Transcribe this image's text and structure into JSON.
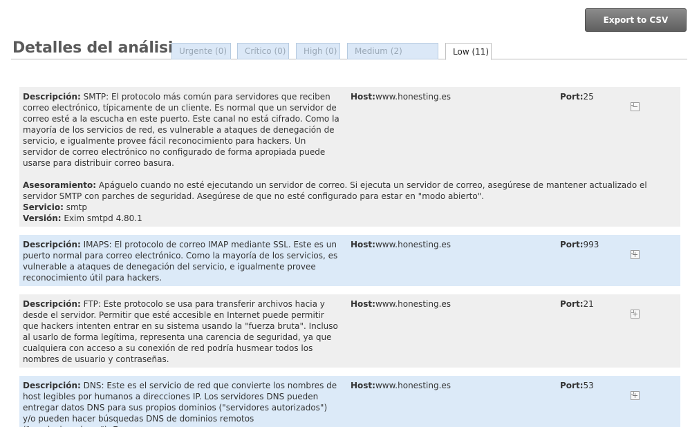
{
  "toolbar": {
    "export_label": "Export to CSV"
  },
  "page": {
    "title": "Detalles del análisis"
  },
  "tabs": [
    {
      "label": "Urgente (0)",
      "active": false
    },
    {
      "label": "Crítico (0)",
      "active": false
    },
    {
      "label": "High (0)",
      "active": false
    },
    {
      "label": "Medium (2)",
      "active": false
    },
    {
      "label": "Low (11)",
      "active": true
    }
  ],
  "labels": {
    "description": "Descripción:",
    "host": "Host:",
    "port": "Port:",
    "advice": "Asesoramiento:",
    "service": "Servicio:",
    "version": "Versión:"
  },
  "icons": {
    "collapse": "collapse-icon",
    "expand": "expand-icon"
  },
  "colors": {
    "row_gray": "#efefef",
    "row_blue": "#dceaf8",
    "tab_inactive": "#dbe8f7"
  },
  "results": [
    {
      "description": "SMTP: El protocolo más común para servidores que reciben correo electrónico, típicamente de un cliente. Es normal que un servidor de correo esté a la escucha en este puerto. Este canal no está cifrado. Como la mayoría de los servicios de red, es vulnerable a ataques de denegación de servicio, e igualmente provee fácil reconocimiento para hackers. Un servidor de correo electrónico no configurado de forma apropiada puede usarse para distribuir correo basura.",
      "host": "www.honesting.es",
      "port": "25",
      "expanded": true,
      "advice": "Apáguelo cuando no esté ejecutando un servidor de correo. Si ejecuta un servidor de correo, asegúrese de mantener actualizado el servidor SMTP con parches de seguridad. Asegúrese de que no esté configurado para estar en \"modo abierto\".",
      "service": "smtp",
      "version": "Exim smtpd 4.80.1"
    },
    {
      "description": "IMAPS: El protocolo de correo IMAP mediante SSL. Este es un puerto normal para correo electrónico. Como la mayoría de los servicios, es vulnerable a ataques de denegación del servicio, e igualmente provee reconocimiento útil para hackers.",
      "host": "www.honesting.es",
      "port": "993",
      "expanded": false
    },
    {
      "description": "FTP: Este protocolo se usa para transferir archivos hacia y desde el servidor. Permitir que esté accesible en Internet puede permitir que hackers intenten entrar en su sistema usando la \"fuerza bruta\". Incluso al usarlo de forma legítima, representa una carencia de seguridad, ya que cualquiera con acceso a su conexión de red podría husmear todos los nombres de usuario y contraseñas.",
      "host": "www.honesting.es",
      "port": "21",
      "expanded": false
    },
    {
      "description": "DNS: Este es el servicio de red que convierte los nombres de host legibles por humanos a direcciones IP. Los servidores DNS pueden entregar datos DNS para sus propios dominios (\"servidores autorizados\") y/o pueden hacer búsquedas DNS de dominios remotos (\"resolucionadores\"). Es",
      "host": "www.honesting.es",
      "port": "53",
      "expanded": false
    }
  ]
}
